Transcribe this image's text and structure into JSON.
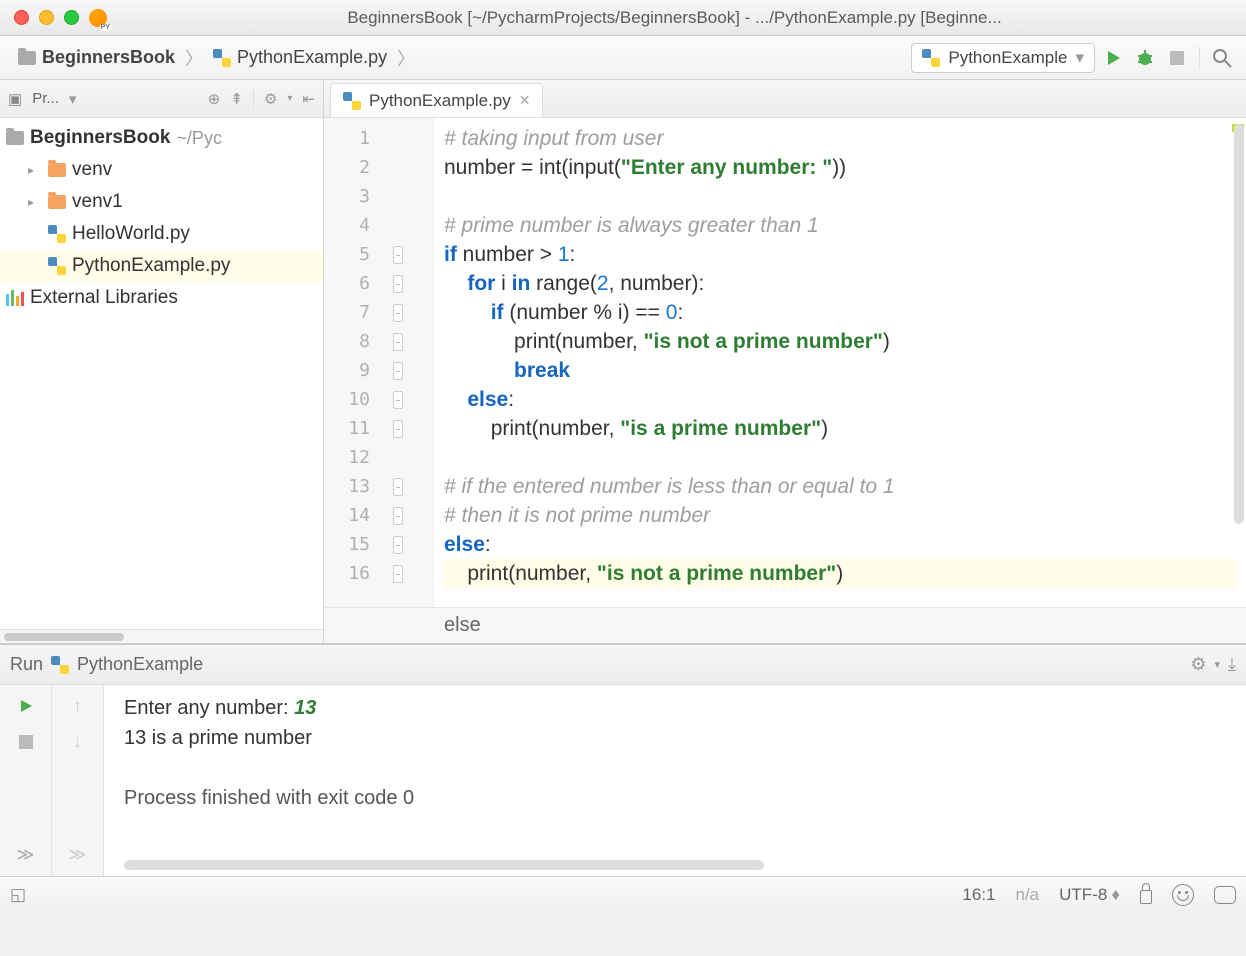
{
  "title": "BeginnersBook [~/PycharmProjects/BeginnersBook] - .../PythonExample.py [Beginne...",
  "breadcrumbs": {
    "project": "BeginnersBook",
    "file": "PythonExample.py"
  },
  "run_config": "PythonExample",
  "sidebar": {
    "header": "Pr...",
    "root": {
      "name": "BeginnersBook",
      "path": "~/Pyc"
    },
    "items": [
      {
        "label": "venv",
        "type": "folder",
        "indent": 1,
        "expandable": true
      },
      {
        "label": "venv1",
        "type": "folder",
        "indent": 1,
        "expandable": true
      },
      {
        "label": "HelloWorld.py",
        "type": "py",
        "indent": 1
      },
      {
        "label": "PythonExample.py",
        "type": "py",
        "indent": 1,
        "selected": true
      }
    ],
    "ext_lib": "External Libraries"
  },
  "editor": {
    "tab": "PythonExample.py",
    "context": "else",
    "lines": [
      {
        "n": 1,
        "fold": "",
        "segs": [
          {
            "t": "# taking input from user",
            "c": "cm"
          }
        ]
      },
      {
        "n": 2,
        "fold": "",
        "segs": [
          {
            "t": "number ",
            "c": "fn"
          },
          {
            "t": "= ",
            "c": "op"
          },
          {
            "t": "int",
            "c": "fn"
          },
          {
            "t": "(",
            "c": "op"
          },
          {
            "t": "input",
            "c": "fn"
          },
          {
            "t": "(",
            "c": "op"
          },
          {
            "t": "\"Enter any number: \"",
            "c": "str"
          },
          {
            "t": "))",
            "c": "op"
          }
        ]
      },
      {
        "n": 3,
        "fold": "",
        "segs": []
      },
      {
        "n": 4,
        "fold": "",
        "segs": [
          {
            "t": "# prime number is always greater than 1",
            "c": "cm"
          }
        ]
      },
      {
        "n": 5,
        "fold": "open",
        "segs": [
          {
            "t": "if ",
            "c": "kw"
          },
          {
            "t": "number > ",
            "c": "fn"
          },
          {
            "t": "1",
            "c": "num"
          },
          {
            "t": ":",
            "c": "op"
          }
        ]
      },
      {
        "n": 6,
        "fold": "open",
        "segs": [
          {
            "t": "    ",
            "c": ""
          },
          {
            "t": "for ",
            "c": "kw"
          },
          {
            "t": "i ",
            "c": "fn"
          },
          {
            "t": "in ",
            "c": "kw"
          },
          {
            "t": "range",
            "c": "fn"
          },
          {
            "t": "(",
            "c": "op"
          },
          {
            "t": "2",
            "c": "num"
          },
          {
            "t": ", number):",
            "c": "fn"
          }
        ]
      },
      {
        "n": 7,
        "fold": "open",
        "segs": [
          {
            "t": "        ",
            "c": ""
          },
          {
            "t": "if ",
            "c": "kw"
          },
          {
            "t": "(number % i) == ",
            "c": "fn"
          },
          {
            "t": "0",
            "c": "num"
          },
          {
            "t": ":",
            "c": "op"
          }
        ]
      },
      {
        "n": 8,
        "fold": "mid",
        "segs": [
          {
            "t": "            ",
            "c": ""
          },
          {
            "t": "print",
            "c": "fn"
          },
          {
            "t": "(number, ",
            "c": "fn"
          },
          {
            "t": "\"is not a prime number\"",
            "c": "str"
          },
          {
            "t": ")",
            "c": "op"
          }
        ]
      },
      {
        "n": 9,
        "fold": "mid",
        "segs": [
          {
            "t": "            ",
            "c": ""
          },
          {
            "t": "break",
            "c": "kw"
          }
        ]
      },
      {
        "n": 10,
        "fold": "open",
        "segs": [
          {
            "t": "    ",
            "c": ""
          },
          {
            "t": "else",
            "c": "kw"
          },
          {
            "t": ":",
            "c": "op"
          }
        ]
      },
      {
        "n": 11,
        "fold": "close",
        "segs": [
          {
            "t": "        ",
            "c": ""
          },
          {
            "t": "print",
            "c": "fn"
          },
          {
            "t": "(number, ",
            "c": "fn"
          },
          {
            "t": "\"is a prime number\"",
            "c": "str"
          },
          {
            "t": ")",
            "c": "op"
          }
        ]
      },
      {
        "n": 12,
        "fold": "",
        "segs": []
      },
      {
        "n": 13,
        "fold": "open",
        "segs": [
          {
            "t": "# if the entered number is less than or equal to 1",
            "c": "cm"
          }
        ]
      },
      {
        "n": 14,
        "fold": "close",
        "segs": [
          {
            "t": "# then it is not prime number",
            "c": "cm"
          }
        ]
      },
      {
        "n": 15,
        "fold": "open",
        "segs": [
          {
            "t": "else",
            "c": "kw"
          },
          {
            "t": ":",
            "c": "op"
          }
        ]
      },
      {
        "n": 16,
        "fold": "close",
        "hl": true,
        "segs": [
          {
            "t": "    ",
            "c": ""
          },
          {
            "t": "print",
            "c": "fn"
          },
          {
            "t": "(number, ",
            "c": "fn"
          },
          {
            "t": "\"is not a prime number\"",
            "c": "str"
          },
          {
            "t": ")",
            "c": "op"
          }
        ]
      }
    ]
  },
  "run_panel": {
    "title": "Run",
    "name": "PythonExample",
    "console": {
      "prompt": "Enter any number: ",
      "input": "13",
      "output": "13 is a prime number",
      "exit": "Process finished with exit code 0"
    }
  },
  "status": {
    "pos": "16:1",
    "context": "n/a",
    "encoding": "UTF-8"
  }
}
